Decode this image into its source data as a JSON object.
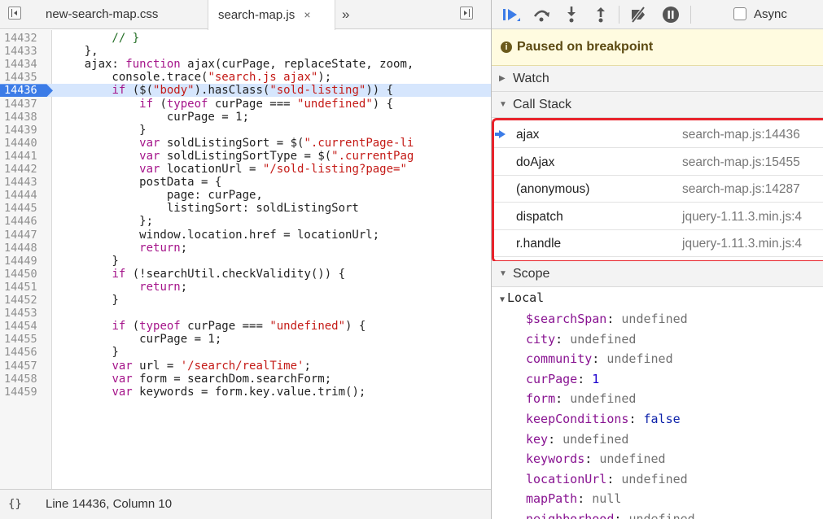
{
  "editor": {
    "tabs": [
      {
        "label": "new-search-map.css",
        "active": false
      },
      {
        "label": "search-map.js",
        "active": true,
        "close": "×"
      }
    ],
    "more_tabs": "»",
    "breakpoint_line": "14436",
    "lines": [
      {
        "n": "14432",
        "code": "        // }"
      },
      {
        "n": "14433",
        "code": "    },"
      },
      {
        "n": "14434",
        "code": "    ajax: function ajax(curPage, replaceState, zoom,"
      },
      {
        "n": "14435",
        "code": "        console.trace(\"search.js ajax\");"
      },
      {
        "n": "14436",
        "code": "        if ($(\"body\").hasClass(\"sold-listing\")) {"
      },
      {
        "n": "14437",
        "code": "            if (typeof curPage === \"undefined\") {"
      },
      {
        "n": "14438",
        "code": "                curPage = 1;"
      },
      {
        "n": "14439",
        "code": "            }"
      },
      {
        "n": "14440",
        "code": "            var soldListingSort = $(\".currentPage-li"
      },
      {
        "n": "14441",
        "code": "            var soldListingSortType = $(\".currentPag"
      },
      {
        "n": "14442",
        "code": "            var locationUrl = \"/sold-listing?page=\""
      },
      {
        "n": "14443",
        "code": "            postData = {"
      },
      {
        "n": "14444",
        "code": "                page: curPage,"
      },
      {
        "n": "14445",
        "code": "                listingSort: soldListingSort"
      },
      {
        "n": "14446",
        "code": "            };"
      },
      {
        "n": "14447",
        "code": "            window.location.href = locationUrl;"
      },
      {
        "n": "14448",
        "code": "            return;"
      },
      {
        "n": "14449",
        "code": "        }"
      },
      {
        "n": "14450",
        "code": "        if (!searchUtil.checkValidity()) {"
      },
      {
        "n": "14451",
        "code": "            return;"
      },
      {
        "n": "14452",
        "code": "        }"
      },
      {
        "n": "14453",
        "code": ""
      },
      {
        "n": "14454",
        "code": "        if (typeof curPage === \"undefined\") {"
      },
      {
        "n": "14455",
        "code": "            curPage = 1;"
      },
      {
        "n": "14456",
        "code": "        }"
      },
      {
        "n": "14457",
        "code": "        var url = '/search/realTime';"
      },
      {
        "n": "14458",
        "code": "        var form = searchDom.searchForm;"
      },
      {
        "n": "14459",
        "code": "        var keywords = form.key.value.trim();"
      }
    ],
    "status": {
      "braces": "{}",
      "position": "Line 14436, Column 10"
    }
  },
  "debugger": {
    "async_label": "Async",
    "async_checked": false,
    "paused_message": "Paused on breakpoint",
    "sections": {
      "watch": "Watch",
      "call_stack": "Call Stack",
      "scope": "Scope"
    },
    "call_stack": [
      {
        "name": "ajax",
        "location": "search-map.js:14436",
        "current": true
      },
      {
        "name": "doAjax",
        "location": "search-map.js:15455",
        "current": false
      },
      {
        "name": "(anonymous)",
        "location": "search-map.js:14287",
        "current": false
      },
      {
        "name": "dispatch",
        "location": "jquery-1.11.3.min.js:4",
        "current": false
      },
      {
        "name": "r.handle",
        "location": "jquery-1.11.3.min.js:4",
        "current": false
      }
    ],
    "scope_local_label": "Local",
    "scope_vars": [
      {
        "name": "$searchSpan",
        "value": "undefined",
        "kind": "undef"
      },
      {
        "name": "city",
        "value": "undefined",
        "kind": "undef"
      },
      {
        "name": "community",
        "value": "undefined",
        "kind": "undef"
      },
      {
        "name": "curPage",
        "value": "1",
        "kind": "num"
      },
      {
        "name": "form",
        "value": "undefined",
        "kind": "undef"
      },
      {
        "name": "keepConditions",
        "value": "false",
        "kind": "bool"
      },
      {
        "name": "key",
        "value": "undefined",
        "kind": "undef"
      },
      {
        "name": "keywords",
        "value": "undefined",
        "kind": "undef"
      },
      {
        "name": "locationUrl",
        "value": "undefined",
        "kind": "undef"
      },
      {
        "name": "mapPath",
        "value": "null",
        "kind": "undef"
      },
      {
        "name": "neighborhood",
        "value": "undefined",
        "kind": "undef"
      }
    ],
    "colors": {
      "accent": "#3c7ce7",
      "highlight_box": "#e8232b",
      "paused_bg": "#fffbe0"
    }
  }
}
